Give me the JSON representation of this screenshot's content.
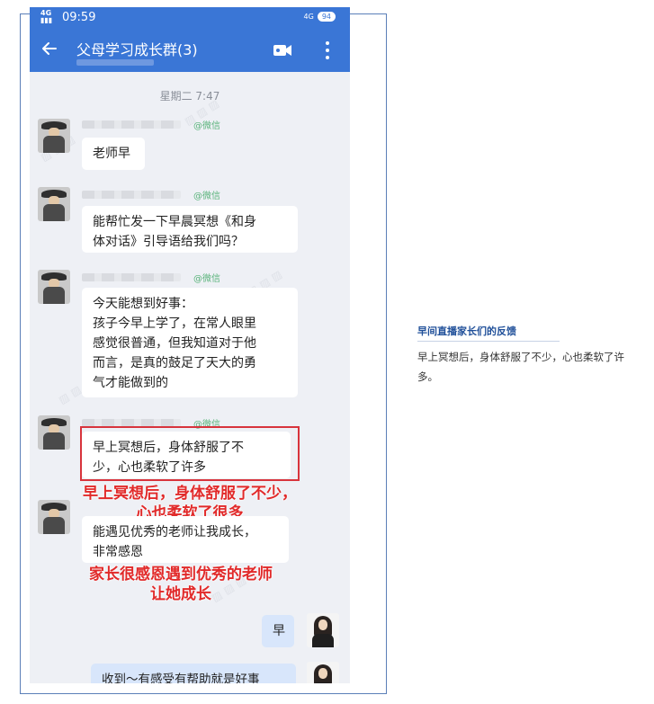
{
  "status_bar": {
    "time": "09:59",
    "signal": "4G",
    "network": "4G",
    "battery": "94"
  },
  "chat": {
    "title": "父母学习成长群(3)"
  },
  "time_separator": "星期二  7:47",
  "wechat_tag": "@微信",
  "messages": [
    {
      "text": "老师早"
    },
    {
      "lines": [
        "能帮忙发一下早晨冥想《和身",
        "体对话》引导语给我们吗？"
      ]
    },
    {
      "lines": [
        "今天能想到好事：",
        "孩子今早上学了，在常人眼里",
        "感觉很普通，但我知道对于他",
        "而言，是真的鼓足了天大的勇",
        "气才能做到的"
      ]
    },
    {
      "lines": [
        "早上冥想后，身体舒服了不",
        "少，心也柔软了许多"
      ]
    },
    {
      "lines": [
        "能遇见优秀的老师让我成长，",
        "非常感恩"
      ]
    }
  ],
  "my_messages": [
    {
      "text": "早"
    },
    {
      "text": "收到～有感受有帮助就是好事"
    }
  ],
  "captions": [
    {
      "lines": [
        "早上冥想后，身体舒服了不少，",
        "心也柔软了很多"
      ]
    },
    {
      "lines": [
        "家长很感恩遇到优秀的老师",
        "让她成长"
      ]
    }
  ],
  "side": {
    "title": "早间直播家长们的反馈",
    "text": "早上冥想后，身体舒服了不少，心也柔软了许多。"
  },
  "colors": {
    "header": "#3a76d6",
    "highlight": "#d8343c",
    "caption": "#e12a2a",
    "side_title": "#1f4f99"
  }
}
